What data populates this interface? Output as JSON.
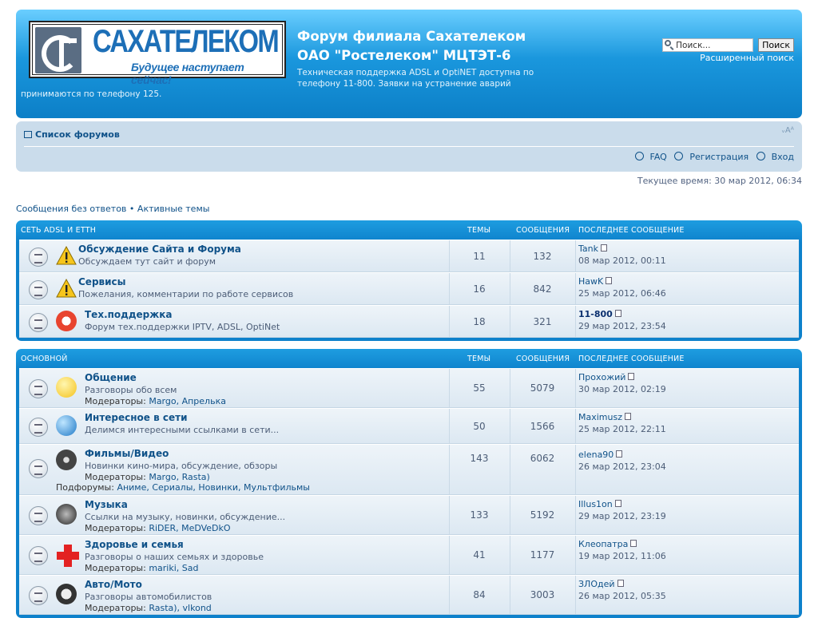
{
  "header": {
    "logo_text": "САХАТЕЛЕКОМ",
    "logo_slogan": "Будущее наступает сейчас!",
    "title": "Форум филиала Сахателеком ОАО \"Ростелеком\" МЦТЭТ-6",
    "desc_line1": "Техническая поддержка ADSL и OptiNET доступна по телефону 11-800. Заявки на устранение аварий",
    "desc_line2": "принимаются по телефону 125.",
    "search_placeholder": "Поиск...",
    "search_button": "Поиск",
    "advanced_search": "Расширенный поиск"
  },
  "nav": {
    "forums_list": "Список форумов",
    "font_size": "ᵥAᴬ",
    "faq": "FAQ",
    "register": "Регистрация",
    "login": "Вход"
  },
  "current_time": "Текущее время: 30 мар 2012, 06:34",
  "quick_links": {
    "unanswered": "Сообщения без ответов",
    "sep": "•",
    "active": "Активные темы"
  },
  "col_headers": {
    "topics": "ТЕМЫ",
    "posts": "СООБЩЕНИЯ",
    "last_post": "ПОСЛЕДНЕЕ СООБЩЕНИЕ"
  },
  "categories": [
    {
      "name": "СЕТЬ ADSL И ETTH",
      "forums": [
        {
          "title": "Обсуждение Сайта и Форума",
          "desc": "Обсуждаем тут сайт и форум",
          "topics": "11",
          "posts": "132",
          "last_user": "Tank",
          "last_date": "08 мар 2012, 00:11",
          "icon": "warning-icon"
        },
        {
          "title": "Сервисы",
          "desc": "Пожелания, комментарии по работе сервисов",
          "topics": "16",
          "posts": "842",
          "last_user": "HawK",
          "last_date": "25 мар 2012, 06:46",
          "icon": "warning-icon"
        },
        {
          "title": "Тех.поддержка",
          "desc": "Форум тех.поддержки IPTV, ADSL, OptiNet",
          "topics": "18",
          "posts": "321",
          "last_user": "11-800",
          "last_date": "29 мар 2012, 23:54",
          "icon": "lifebuoy-icon"
        }
      ]
    },
    {
      "name": "ОСНОВНОЙ",
      "forums": [
        {
          "title": "Общение",
          "desc": "Разговоры обо всем",
          "mods_label": "Модераторы:",
          "mods": "Margo, Апрелька",
          "topics": "55",
          "posts": "5079",
          "last_user": "Прохожий",
          "last_date": "30 мар 2012, 02:19",
          "icon": "speech-bubble-icon"
        },
        {
          "title": "Интересное в сети",
          "desc": "Делимся интересными ссылками в сети...",
          "topics": "50",
          "posts": "1566",
          "last_user": "Maximusz",
          "last_date": "25 мар 2012, 22:11",
          "icon": "globe-icon"
        },
        {
          "title": "Фильмы/Видео",
          "desc": "Новинки кино-мира, обсуждение, обзоры",
          "mods_label": "Модераторы:",
          "mods": "Margo, Rasta)",
          "subforums_label": "Подфорумы:",
          "subforums": "Аниме, Сериалы, Новинки, Мультфильмы",
          "topics": "143",
          "posts": "6062",
          "last_user": "elena90",
          "last_date": "26 мар 2012, 23:04",
          "icon": "film-reel-icon"
        },
        {
          "title": "Музыка",
          "desc": "Ссылки на музыку, новинки, обсуждение...",
          "mods_label": "Модераторы:",
          "mods": "RiDER, MeDVeDkO",
          "topics": "133",
          "posts": "5192",
          "last_user": "Illus1on",
          "last_date": "29 мар 2012, 23:19",
          "icon": "speaker-icon"
        },
        {
          "title": "Здоровье и семья",
          "desc": "Разговоры о наших семьях и здоровье",
          "mods_label": "Модераторы:",
          "mods": "mariki, Sad",
          "topics": "41",
          "posts": "1177",
          "last_user": "Клеопатра",
          "last_date": "19 мар 2012, 11:06",
          "icon": "red-cross-icon"
        },
        {
          "title": "Авто/Мото",
          "desc": "Разговоры автомобилистов",
          "mods_label": "Модераторы:",
          "mods": "Rasta), vlkond",
          "topics": "84",
          "posts": "3003",
          "last_user": "ЗЛОдей",
          "last_date": "26 мар 2012, 05:35",
          "icon": "tire-icon"
        }
      ]
    }
  ]
}
